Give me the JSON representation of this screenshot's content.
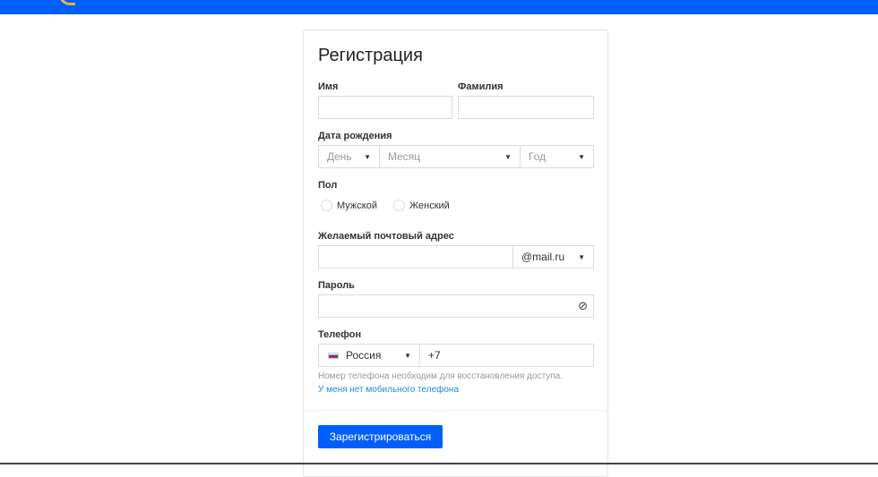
{
  "title": "Регистрация",
  "fields": {
    "first_name_label": "Имя",
    "last_name_label": "Фамилия",
    "birth_label": "Дата рождения",
    "day": "День",
    "month": "Месяц",
    "year": "Год",
    "gender_label": "Пол",
    "male": "Мужской",
    "female": "Женский",
    "email_label": "Желаемый почтовый адрес",
    "domain": "@mail.ru",
    "password_label": "Пароль",
    "phone_label": "Телефон",
    "country": "Россия",
    "phone_prefix": "+7"
  },
  "hint": "Номер телефона необходим для восстановления доступа.",
  "no_phone_link": "У меня нет мобильного телефона",
  "submit": "Зарегистрироваться",
  "colors": {
    "brand": "#005ff9",
    "link": "#168de2"
  }
}
